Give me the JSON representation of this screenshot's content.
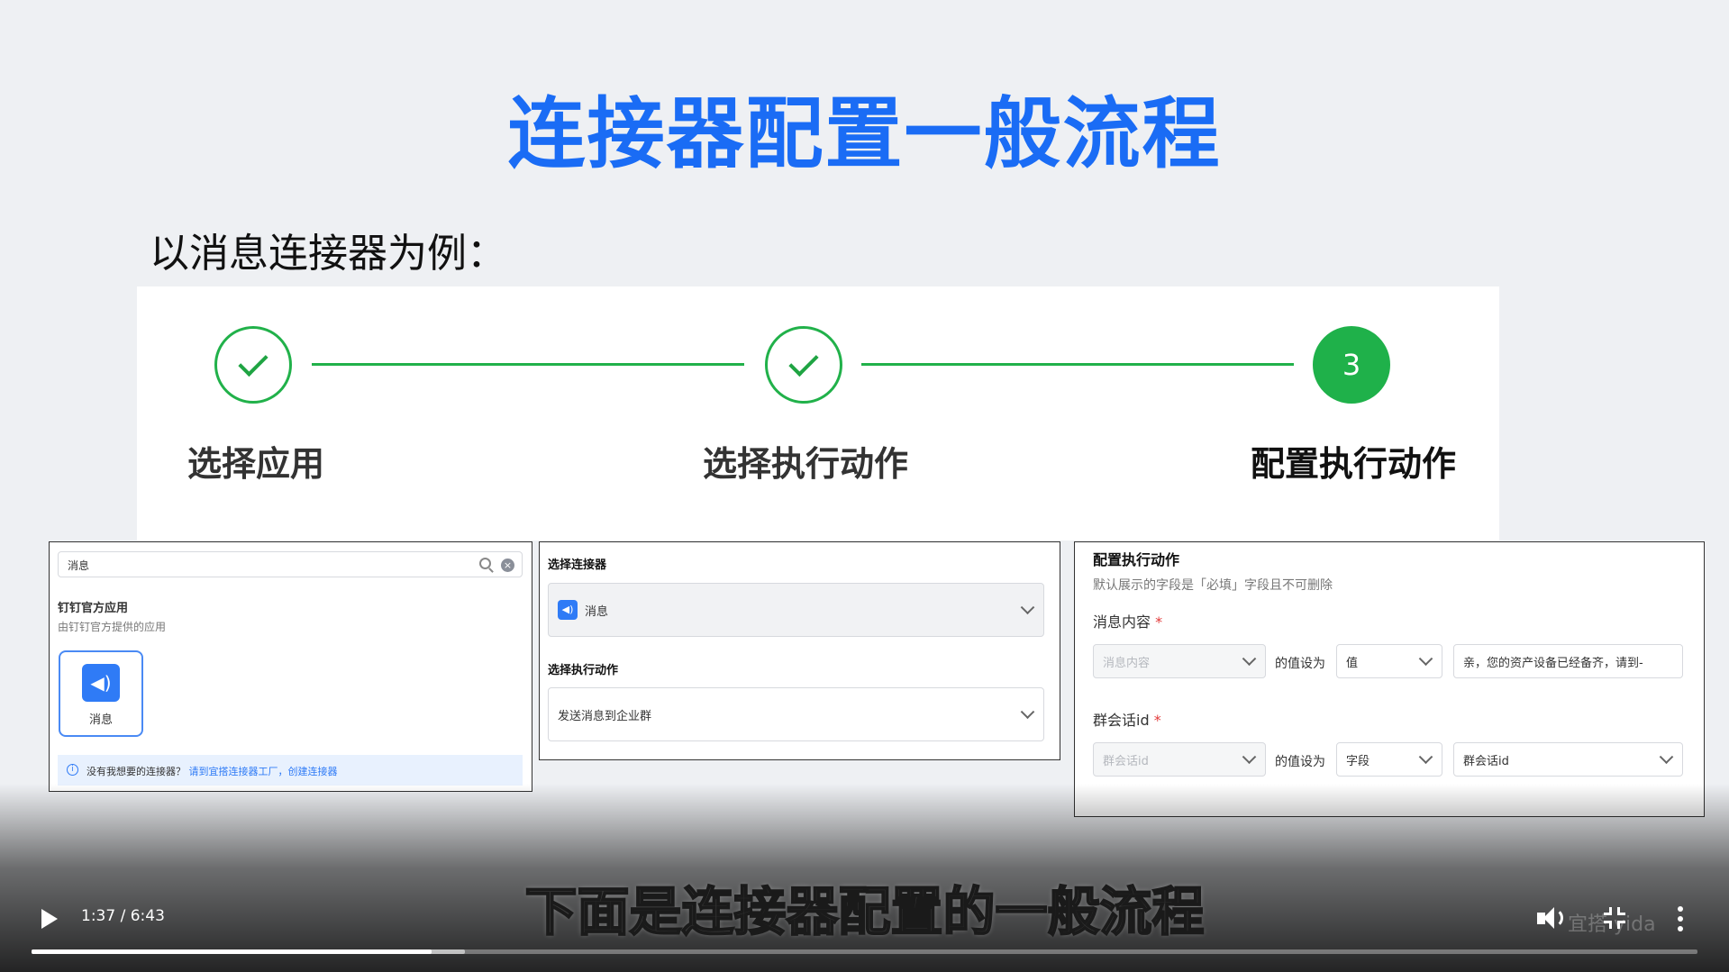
{
  "slide": {
    "title": "连接器配置一般流程",
    "subtitle": "以消息连接器为例："
  },
  "steps": [
    {
      "label": "选择应用",
      "state": "done"
    },
    {
      "label": "选择执行动作",
      "state": "done"
    },
    {
      "label": "配置执行动作",
      "state": "current",
      "number": "3"
    }
  ],
  "panel1": {
    "search_value": "消息",
    "section_title": "钉钉官方应用",
    "section_desc": "由钉钉官方提供的应用",
    "app_name": "消息",
    "tip_text": "没有我想要的连接器？",
    "tip_link": "请到宜搭连接器工厂，创建连接器"
  },
  "panel2": {
    "connector_label": "选择连接器",
    "connector_value": "消息",
    "action_label": "选择执行动作",
    "action_value": "发送消息到企业群"
  },
  "panel3": {
    "title": "配置执行动作",
    "desc": "默认展示的字段是「必填」字段且不可删除",
    "field1_label": "消息内容",
    "field1_select": "消息内容",
    "value_is_text": "的值设为",
    "field1_type": "值",
    "field1_value": "亲，您的资产设备已经备齐，请到-",
    "field2_label": "群会话id",
    "field2_select": "群会话id",
    "field2_type": "字段",
    "field2_value": "群会话id",
    "required_mark": "*"
  },
  "player": {
    "caption": "下面是连接器配置的一般流程",
    "time": "1:37 / 6:43",
    "progress_fraction": 0.24,
    "buffer_fraction": 0.26,
    "watermark": "宜搭 yida"
  },
  "colors": {
    "title_blue": "#1a6cf5",
    "step_green": "#21b14a",
    "link_blue": "#2f7bf6",
    "required_red": "#e23b3b"
  }
}
